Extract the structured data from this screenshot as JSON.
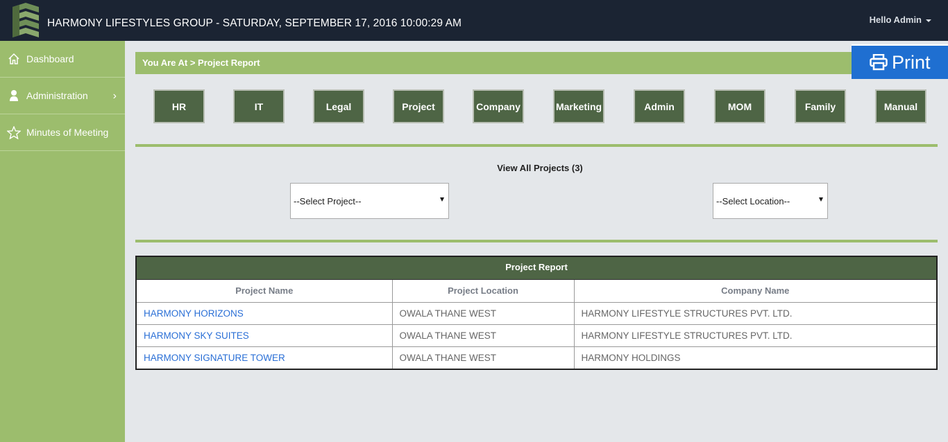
{
  "header": {
    "title": "HARMONY LIFESTYLES GROUP - SATURDAY, SEPTEMBER 17, 2016 10:00:29 AM",
    "user_greeting": "Hello Admin"
  },
  "sidebar": {
    "items": [
      {
        "label": "Dashboard",
        "icon": "home-icon"
      },
      {
        "label": "Administration",
        "icon": "user-icon",
        "has_submenu": true
      },
      {
        "label": "Minutes of Meeting",
        "icon": "star-icon"
      }
    ],
    "chevron": "›"
  },
  "breadcrumb": "You Are At > Project Report",
  "print_label": "Print",
  "categories": [
    "HR",
    "IT",
    "Legal",
    "Project",
    "Company",
    "Marketing",
    "Admin",
    "MOM",
    "Family",
    "Manual"
  ],
  "view_all_label": "View All Projects (3)",
  "filters": {
    "project_select": "--Select Project--",
    "location_select": "--Select Location--"
  },
  "report": {
    "title": "Project Report",
    "columns": [
      "Project Name",
      "Project Location",
      "Company Name"
    ],
    "rows": [
      [
        "HARMONY HORIZONS",
        "OWALA THANE WEST",
        "HARMONY LIFESTYLE STRUCTURES PVT. LTD."
      ],
      [
        "HARMONY SKY SUITES",
        "OWALA THANE WEST",
        "HARMONY LIFESTYLE STRUCTURES PVT. LTD."
      ],
      [
        "HARMONY SIGNATURE TOWER",
        "OWALA THANE WEST",
        "HARMONY HOLDINGS"
      ]
    ]
  },
  "colors": {
    "topbar": "#1b2433",
    "accent_green": "#9cbd6d",
    "dark_green": "#4e6545",
    "print_blue": "#1f6fd1",
    "link_blue": "#2a6fd6"
  }
}
